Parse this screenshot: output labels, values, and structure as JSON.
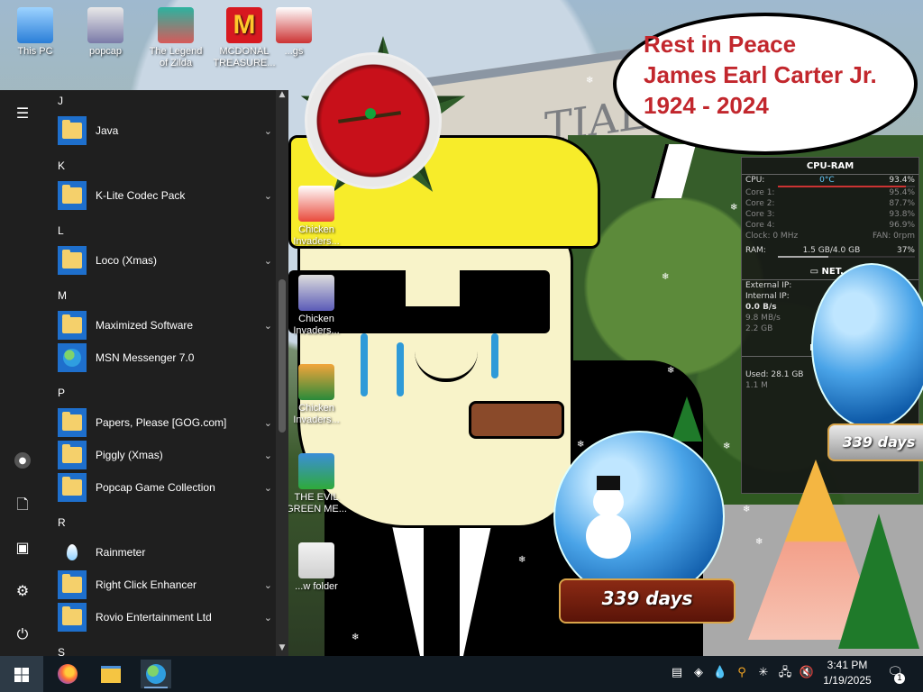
{
  "desktop": {
    "icons": [
      {
        "label": "This PC"
      },
      {
        "label": "popcap"
      },
      {
        "label": "The Legend of Zilda"
      },
      {
        "label": "MCDONAL TREASURE..."
      },
      {
        "label": "...gs"
      },
      {
        "label": "Chicken Invaders..."
      },
      {
        "label": "Chicken Invaders..."
      },
      {
        "label": "Chicken Invaders..."
      },
      {
        "label": "THE EVIL GREEN ME..."
      },
      {
        "label": "...w folder"
      }
    ],
    "wallpaper_text": "...TIAL",
    "speech_bubble": {
      "line1": "Rest in Peace",
      "line2": "James Earl Carter Jr.",
      "line3": "1924 - 2024"
    }
  },
  "widgets": {
    "cpu_ram": {
      "title": "CPU-RAM",
      "cpu_label": "CPU:",
      "cpu_temp": "0°C",
      "cpu_value": "93.4%",
      "cpu_pct": 93.4,
      "cores": [
        {
          "label": "Core 1:",
          "value": "95.4%",
          "pct": 95.4
        },
        {
          "label": "Core 2:",
          "value": "87.7%",
          "pct": 87.7
        },
        {
          "label": "Core 3:",
          "value": "93.8%",
          "pct": 93.8
        },
        {
          "label": "Core 4:",
          "value": "96.9%",
          "pct": 96.9
        }
      ],
      "clock": "Clock: 0 MHz",
      "fan": "FAN: 0rpm",
      "ram_label": "RAM:",
      "ram_value": "1.5 GB/4.0 GB",
      "ram_pct_text": "37%",
      "ram_pct": 37
    },
    "network": {
      "title": "NET...",
      "external_ip_label": "External IP:",
      "internal_ip_label": "Internal IP:",
      "speed_up": "0.0 B/s",
      "speed_down": "9.8 MB/s",
      "total": "2.2 GB"
    },
    "drives": {
      "title": "DRIVE...",
      "used_label": "Used: 28.1 GB",
      "sub": "1.1 M"
    },
    "snow_globes": [
      {
        "caption": "339 days"
      },
      {
        "caption": "339 days"
      }
    ]
  },
  "start_menu": {
    "sections": [
      {
        "letter": "J",
        "apps": [
          {
            "label": "Java",
            "expandable": true,
            "icon": "folder-icon"
          }
        ]
      },
      {
        "letter": "K",
        "apps": [
          {
            "label": "K-Lite Codec Pack",
            "expandable": true,
            "icon": "folder-icon"
          }
        ]
      },
      {
        "letter": "L",
        "apps": [
          {
            "label": "Loco (Xmas)",
            "expandable": true,
            "icon": "folder-icon"
          }
        ]
      },
      {
        "letter": "M",
        "apps": [
          {
            "label": "Maximized Software",
            "expandable": true,
            "icon": "folder-icon"
          },
          {
            "label": "MSN Messenger 7.0",
            "expandable": false,
            "icon": "msn-icon"
          }
        ]
      },
      {
        "letter": "P",
        "apps": [
          {
            "label": "Papers, Please [GOG.com]",
            "expandable": true,
            "icon": "folder-icon"
          },
          {
            "label": "Piggly (Xmas)",
            "expandable": true,
            "icon": "folder-icon"
          },
          {
            "label": "Popcap Game Collection",
            "expandable": true,
            "icon": "folder-icon"
          }
        ]
      },
      {
        "letter": "R",
        "apps": [
          {
            "label": "Rainmeter",
            "expandable": false,
            "icon": "rainmeter-icon"
          },
          {
            "label": "Right Click Enhancer",
            "expandable": true,
            "icon": "folder-icon"
          },
          {
            "label": "Rovio Entertainment Ltd",
            "expandable": true,
            "icon": "folder-icon"
          }
        ]
      },
      {
        "letter": "S",
        "apps": []
      }
    ],
    "rail_icons": [
      "hamburger-icon",
      "user-icon",
      "documents-icon",
      "pictures-icon",
      "settings-icon",
      "power-icon"
    ]
  },
  "taskbar": {
    "pinned": [
      "firefox-icon",
      "file-explorer-icon",
      "msn-icon"
    ],
    "tray_icons": [
      "task-manager-icon",
      "app-icon",
      "rainmeter-icon",
      "search-tool-icon",
      "snowflake-icon",
      "network-icon",
      "volume-icon"
    ],
    "time": "3:41 PM",
    "date": "1/19/2025",
    "notification_count": "1"
  },
  "colors": {
    "menu_bg": "#1f1f1f",
    "tile_blue": "#1e6fcc",
    "taskbar_bg": "#111a22",
    "bubble_text": "#c2272d"
  }
}
